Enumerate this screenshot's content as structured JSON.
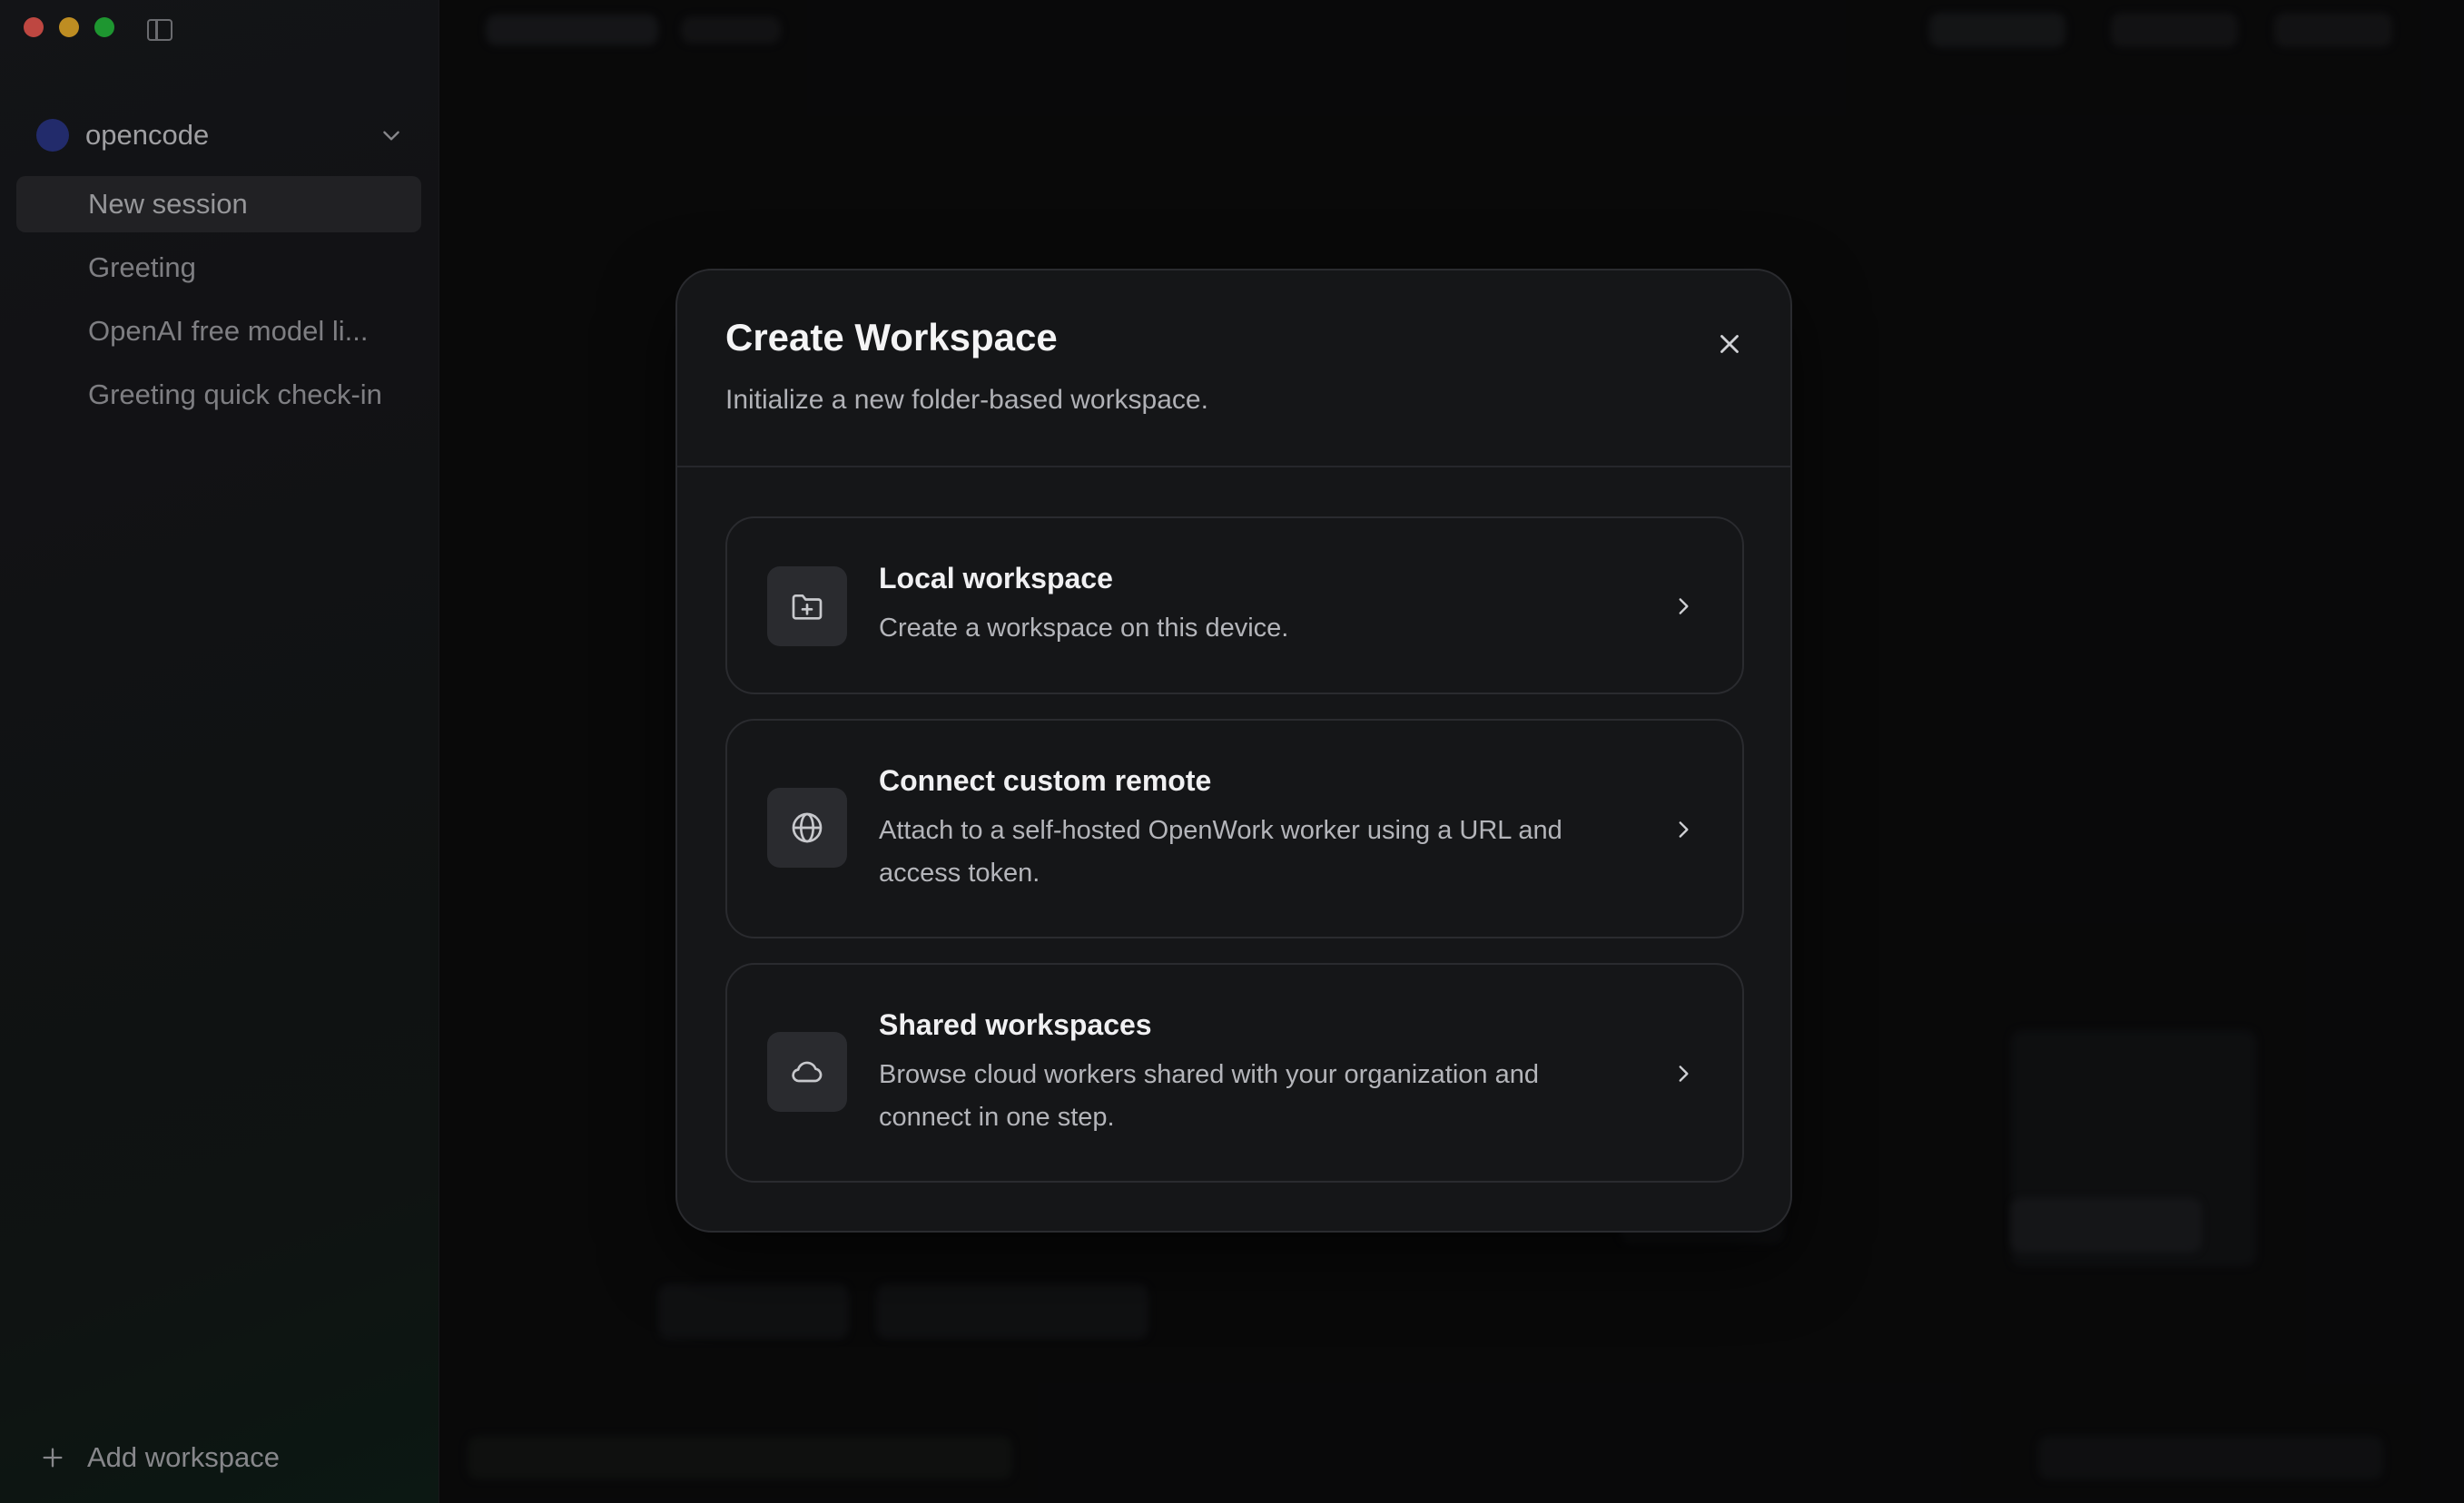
{
  "window": {
    "traffic_lights": [
      "close",
      "minimize",
      "zoom"
    ],
    "colors": {
      "red": "#fe5f57",
      "yellow": "#febc2e",
      "green": "#28c840"
    }
  },
  "sidebar": {
    "project": {
      "name": "opencode",
      "avatar_color": "#2e3a8f"
    },
    "sessions": [
      {
        "label": "New session",
        "active": true
      },
      {
        "label": "Greeting",
        "active": false
      },
      {
        "label": "OpenAI free model li...",
        "active": false
      },
      {
        "label": "Greeting quick check-in",
        "active": false
      }
    ],
    "add_workspace_label": "Add workspace"
  },
  "modal": {
    "title": "Create Workspace",
    "subtitle": "Initialize a new folder-based workspace.",
    "options": [
      {
        "title": "Local workspace",
        "description": "Create a workspace on this device.",
        "icon": "folder-plus-icon"
      },
      {
        "title": "Connect custom remote",
        "description": "Attach to a self-hosted OpenWork worker using a URL and access token.",
        "icon": "globe-icon"
      },
      {
        "title": "Shared workspaces",
        "description": "Browse cloud workers shared with your organization and connect in one step.",
        "icon": "cloud-icon"
      }
    ]
  }
}
